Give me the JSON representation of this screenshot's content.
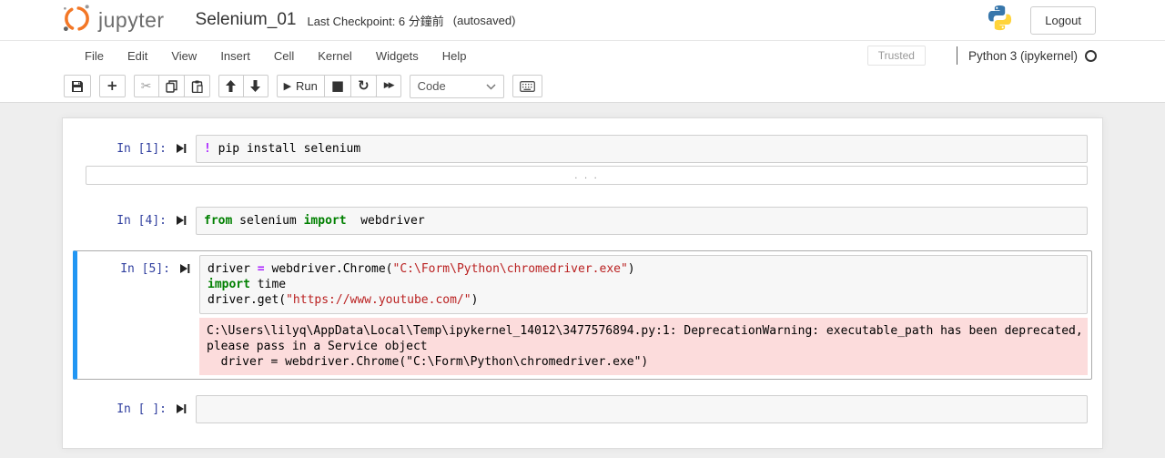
{
  "header": {
    "logo_text": "jupyter",
    "title": "Selenium_01",
    "checkpoint": "Last Checkpoint: 6 分鐘前",
    "autosaved": "(autosaved)",
    "logout_label": "Logout"
  },
  "menubar": {
    "items": [
      "File",
      "Edit",
      "View",
      "Insert",
      "Cell",
      "Kernel",
      "Widgets",
      "Help"
    ],
    "trusted_label": "Trusted",
    "kernel_name": "Python 3 (ipykernel)"
  },
  "toolbar": {
    "run_label": "Run",
    "cell_type_value": "Code",
    "glyphs": {
      "add": "+",
      "cut": "✂",
      "run": "▶",
      "stop": "■",
      "restart": "↻",
      "fast_forward": "▶▶"
    }
  },
  "cells": [
    {
      "prompt": "In [1]:",
      "lines": [
        {
          "segs": [
            {
              "t": "!"
            },
            {
              "t": " pip install selenium"
            }
          ]
        }
      ],
      "collapsed_output": ". . ."
    },
    {
      "prompt": "In [4]:",
      "lines": [
        {
          "segs": [
            {
              "t": "from"
            },
            {
              "t": " selenium "
            },
            {
              "t": "import"
            },
            {
              "t": "  webdriver"
            }
          ]
        }
      ]
    },
    {
      "prompt": "In [5]:",
      "lines": [
        {
          "segs": [
            {
              "t": "driver "
            },
            {
              "t": "="
            },
            {
              "t": " webdriver.Chrome("
            },
            {
              "t": "\"C:\\Form\\Python\\chromedriver.exe\""
            },
            {
              "t": ")"
            }
          ]
        },
        {
          "segs": [
            {
              "t": "import"
            },
            {
              "t": " time"
            }
          ]
        },
        {
          "segs": [
            {
              "t": "driver.get("
            },
            {
              "t": "\"https://www.youtube.com/\""
            },
            {
              "t": ")"
            }
          ]
        }
      ],
      "stderr": [
        "C:\\Users\\lilyq\\AppData\\Local\\Temp\\ipykernel_14012\\3477576894.py:1: DeprecationWarning: executable_path has been deprecated,",
        "please pass in a Service object",
        "  driver = webdriver.Chrome(\"C:\\Form\\Python\\chromedriver.exe\")"
      ]
    },
    {
      "prompt": "In [ ]:",
      "lines": [
        {
          "segs": [
            {
              "t": ""
            }
          ]
        }
      ]
    }
  ],
  "colors": {
    "accent_blue": "#2196f3",
    "prompt_navy": "#303f9f",
    "keyword_green": "#008000",
    "string_red": "#ba2121",
    "operator_purple": "#aa22ff",
    "stderr_pink": "#fcdcdc",
    "jupyter_orange": "#f37726"
  }
}
